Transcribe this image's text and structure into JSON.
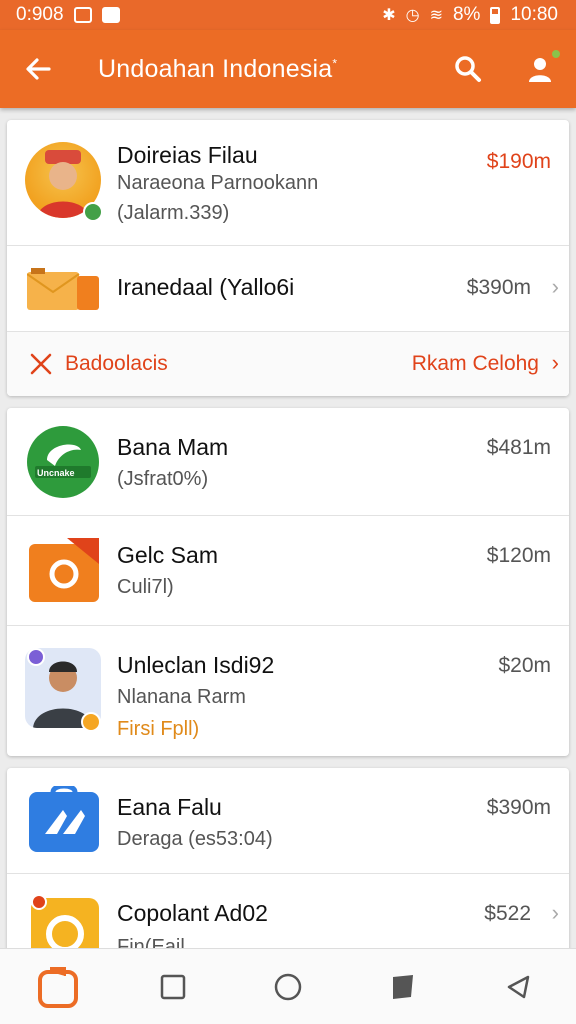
{
  "status": {
    "time": "0:908",
    "right_time": "10:80",
    "battery": "8%"
  },
  "appbar": {
    "title": "Undoahan Indonesia",
    "title_mark": "*"
  },
  "cards": [
    {
      "rows": [
        {
          "name": "Doireias Filau",
          "sub1": "Naraeona Parnookann",
          "sub2": "(Jalarm.339)",
          "price": "$190m",
          "price_accent": true
        },
        {
          "name": "Iranedaal (Yallo6i",
          "price": "$390m",
          "chevron": "›"
        },
        {
          "action_label": "Badoolacis",
          "action_right": "Rkam Celohg",
          "chevron": "›"
        }
      ]
    },
    {
      "rows": [
        {
          "name": "Bana Mam",
          "sub1": "(Jsfrat0%)",
          "price": "$481m",
          "logo_text": "Uncnake"
        },
        {
          "name": "Gelc Sam",
          "sub1": "Culi7l)",
          "price": "$120m"
        },
        {
          "name": "Unleclan Isdi92",
          "sub1": "Nlanana Rarm",
          "sub2": "Firsi Fpll)",
          "price": "$20m"
        }
      ]
    },
    {
      "rows": [
        {
          "name": "Eana Falu",
          "sub1": "Deraga (es53:04)",
          "price": "$390m"
        },
        {
          "name": "Copolant Ad02",
          "sub1": "Fin(Eail",
          "price": "$522",
          "chevron": "›"
        }
      ]
    }
  ],
  "colors": {
    "brand": "#ec6c25",
    "accent_red": "#e0431a",
    "accent_orange": "#e08a1a"
  }
}
